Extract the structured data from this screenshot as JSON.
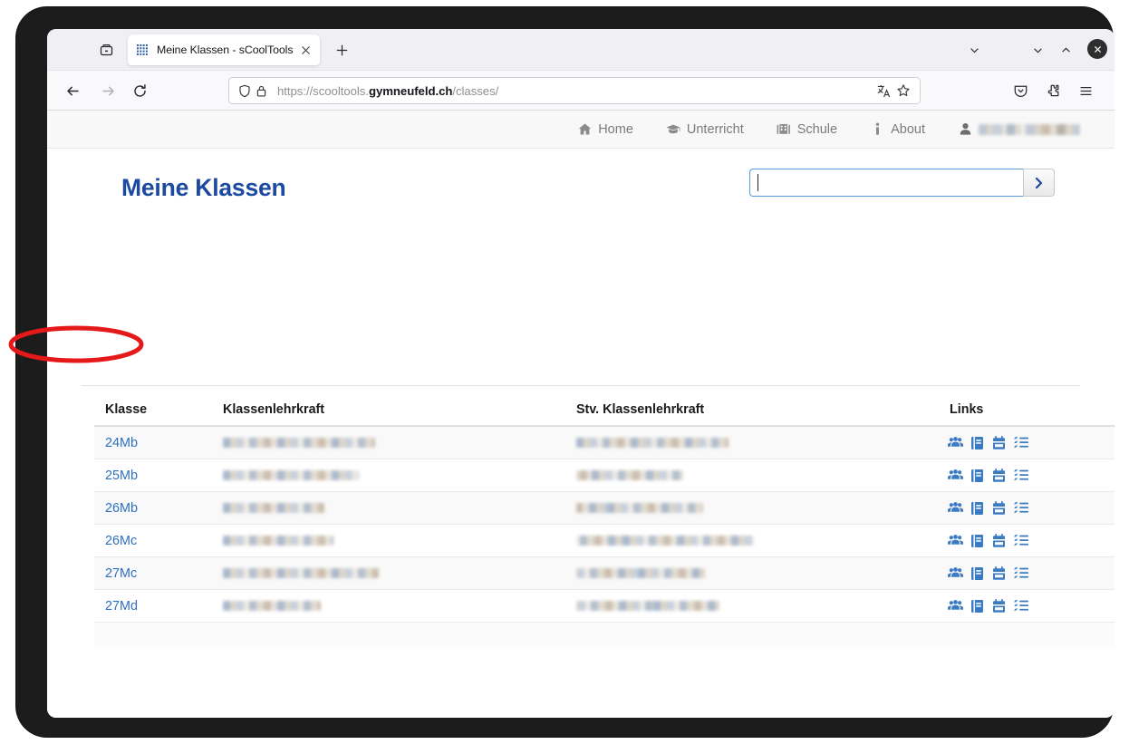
{
  "browser": {
    "firefox_view_label": "Firefox View",
    "tab": {
      "title": "Meine Klassen - sCoolTools",
      "favicon": "grid-dots-icon",
      "close": "close-icon"
    },
    "new_tab_label": "+",
    "toolbar": {
      "back": "back-arrow-icon",
      "forward": "forward-arrow-icon",
      "reload": "reload-icon",
      "shield": "shield-icon",
      "lock": "lock-icon",
      "url_prefix": "https://scooltools.",
      "url_domain": "gymneufeld.ch",
      "url_suffix": "/classes/",
      "url_full": "https://scooltools.gymneufeld.ch/classes/",
      "translate": "translate-icon",
      "bookmark": "bookmark-star-icon",
      "pocket": "pocket-icon",
      "extensions": "extensions-puzzle-icon",
      "app_menu": "hamburger-menu-icon"
    },
    "window_controls": {
      "list_all_tabs": "chevron-down-icon",
      "minimize": "minimize-icon",
      "maximize": "maximize-icon",
      "close": "window-close-icon"
    }
  },
  "site_nav": {
    "items": [
      {
        "label": "Home",
        "icon": "home-icon"
      },
      {
        "label": "Unterricht",
        "icon": "graduation-cap-icon"
      },
      {
        "label": "Schule",
        "icon": "university-icon"
      },
      {
        "label": "About",
        "icon": "info-icon"
      }
    ],
    "user": {
      "icon": "user-icon",
      "name_redacted": true
    }
  },
  "page": {
    "title": "Meine Klassen",
    "search": {
      "value": "",
      "placeholder": "",
      "submit_label": "›"
    }
  },
  "table": {
    "columns": [
      "Klasse",
      "Klassenlehrkraft",
      "Stv. Klassenlehrkraft",
      "Links"
    ],
    "link_icons": [
      "users-group-icon",
      "book-icon",
      "calendar-icon",
      "task-list-icon"
    ],
    "rows": [
      {
        "klasse": "24Mb",
        "lehrkraft_redacted": 168,
        "stv_redacted": 168,
        "highlighted": true
      },
      {
        "klasse": "25Mb",
        "lehrkraft_redacted": 150,
        "stv_redacted": 118,
        "highlighted": false
      },
      {
        "klasse": "26Mb",
        "lehrkraft_redacted": 112,
        "stv_redacted": 140,
        "highlighted": false
      },
      {
        "klasse": "26Mc",
        "lehrkraft_redacted": 122,
        "stv_redacted": 196,
        "highlighted": false
      },
      {
        "klasse": "27Mc",
        "lehrkraft_redacted": 172,
        "stv_redacted": 142,
        "highlighted": false
      },
      {
        "klasse": "27Md",
        "lehrkraft_redacted": 108,
        "stv_redacted": 158,
        "highlighted": false
      }
    ]
  },
  "annotation": {
    "type": "ellipse",
    "color": "#e51919",
    "target": "24Mb"
  },
  "colors": {
    "title_blue": "#1b4aa0",
    "link_blue": "#2f6fbf",
    "icon_blue": "#3a7bc2",
    "annotation_red": "#e51919",
    "search_border": "#5b9bd5"
  }
}
